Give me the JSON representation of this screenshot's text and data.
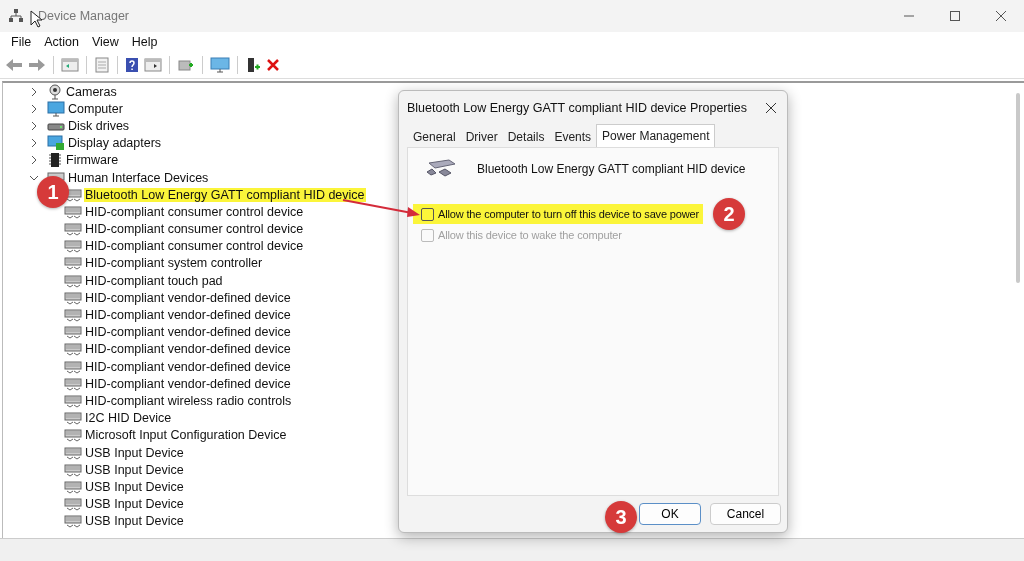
{
  "window": {
    "title": "Device Manager"
  },
  "menu": [
    "File",
    "Action",
    "View",
    "Help"
  ],
  "tree": [
    {
      "label": "Cameras",
      "kind": "camera",
      "expanded": false
    },
    {
      "label": "Computer",
      "kind": "monitor",
      "expanded": false
    },
    {
      "label": "Disk drives",
      "kind": "disk",
      "expanded": false
    },
    {
      "label": "Display adapters",
      "kind": "display",
      "expanded": false
    },
    {
      "label": "Firmware",
      "kind": "chip",
      "expanded": false
    },
    {
      "label": "Human Interface Devices",
      "kind": "hid",
      "expanded": true,
      "children": [
        {
          "label": "Bluetooth Low Energy GATT compliant HID device",
          "highlighted": true
        },
        {
          "label": "HID-compliant consumer control device",
          "highlighted": false
        },
        {
          "label": "HID-compliant consumer control device",
          "highlighted": false
        },
        {
          "label": "HID-compliant consumer control device",
          "highlighted": false
        },
        {
          "label": "HID-compliant system controller",
          "highlighted": false
        },
        {
          "label": "HID-compliant touch pad",
          "highlighted": false
        },
        {
          "label": "HID-compliant vendor-defined device",
          "highlighted": false
        },
        {
          "label": "HID-compliant vendor-defined device",
          "highlighted": false
        },
        {
          "label": "HID-compliant vendor-defined device",
          "highlighted": false
        },
        {
          "label": "HID-compliant vendor-defined device",
          "highlighted": false
        },
        {
          "label": "HID-compliant vendor-defined device",
          "highlighted": false
        },
        {
          "label": "HID-compliant vendor-defined device",
          "highlighted": false
        },
        {
          "label": "HID-compliant wireless radio controls",
          "highlighted": false
        },
        {
          "label": "I2C HID Device",
          "highlighted": false
        },
        {
          "label": "Microsoft Input Configuration Device",
          "highlighted": false
        },
        {
          "label": "USB Input Device",
          "highlighted": false
        },
        {
          "label": "USB Input Device",
          "highlighted": false
        },
        {
          "label": "USB Input Device",
          "highlighted": false
        },
        {
          "label": "USB Input Device",
          "highlighted": false
        },
        {
          "label": "USB Input Device",
          "highlighted": false
        }
      ]
    }
  ],
  "dialog": {
    "title": "Bluetooth Low Energy GATT compliant HID device Properties",
    "tabs": [
      {
        "label": "General",
        "selected": false
      },
      {
        "label": "Driver",
        "selected": false
      },
      {
        "label": "Details",
        "selected": false
      },
      {
        "label": "Events",
        "selected": false
      },
      {
        "label": "Power Management",
        "selected": true
      }
    ],
    "device_name": "Bluetooth Low Energy GATT compliant HID device",
    "options": [
      {
        "label": "Allow the computer to turn off this device to save power",
        "checked": false,
        "disabled": false,
        "highlighted": true
      },
      {
        "label": "Allow this device to wake the computer",
        "checked": false,
        "disabled": true,
        "highlighted": false
      }
    ],
    "buttons": [
      {
        "label": "OK",
        "default": true
      },
      {
        "label": "Cancel",
        "default": false
      }
    ]
  },
  "callouts": [
    "1",
    "2",
    "3"
  ]
}
